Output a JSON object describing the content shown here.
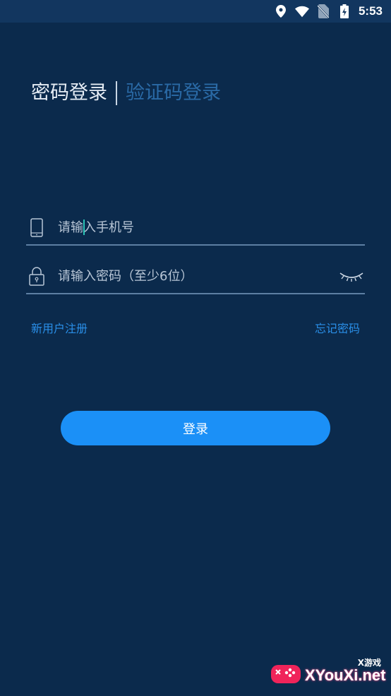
{
  "status_bar": {
    "time": "5:53",
    "icons": [
      "location-icon",
      "wifi-icon",
      "no-sim-icon",
      "battery-charging-icon"
    ]
  },
  "tabs": [
    {
      "label": "密码登录",
      "active": true
    },
    {
      "label": "验证码登录",
      "active": false
    }
  ],
  "phone_field": {
    "icon": "phone-icon",
    "placeholder": "请输入手机号",
    "value": ""
  },
  "password_field": {
    "icon": "lock-icon",
    "placeholder": "请输入密码（至少6位）",
    "value": "",
    "toggle_icon": "eye-closed-icon"
  },
  "links": {
    "register": "新用户注册",
    "forgot": "忘记密码"
  },
  "login_button": {
    "label": "登录"
  },
  "watermark": {
    "small_text": "X游戏",
    "main_text": "XYouXi.net"
  },
  "colors": {
    "background": "#0b2a4c",
    "status_bar": "#12365f",
    "accent": "#1b90f7",
    "link": "#2a8fe8",
    "inactive_tab": "#2a6aa6"
  }
}
